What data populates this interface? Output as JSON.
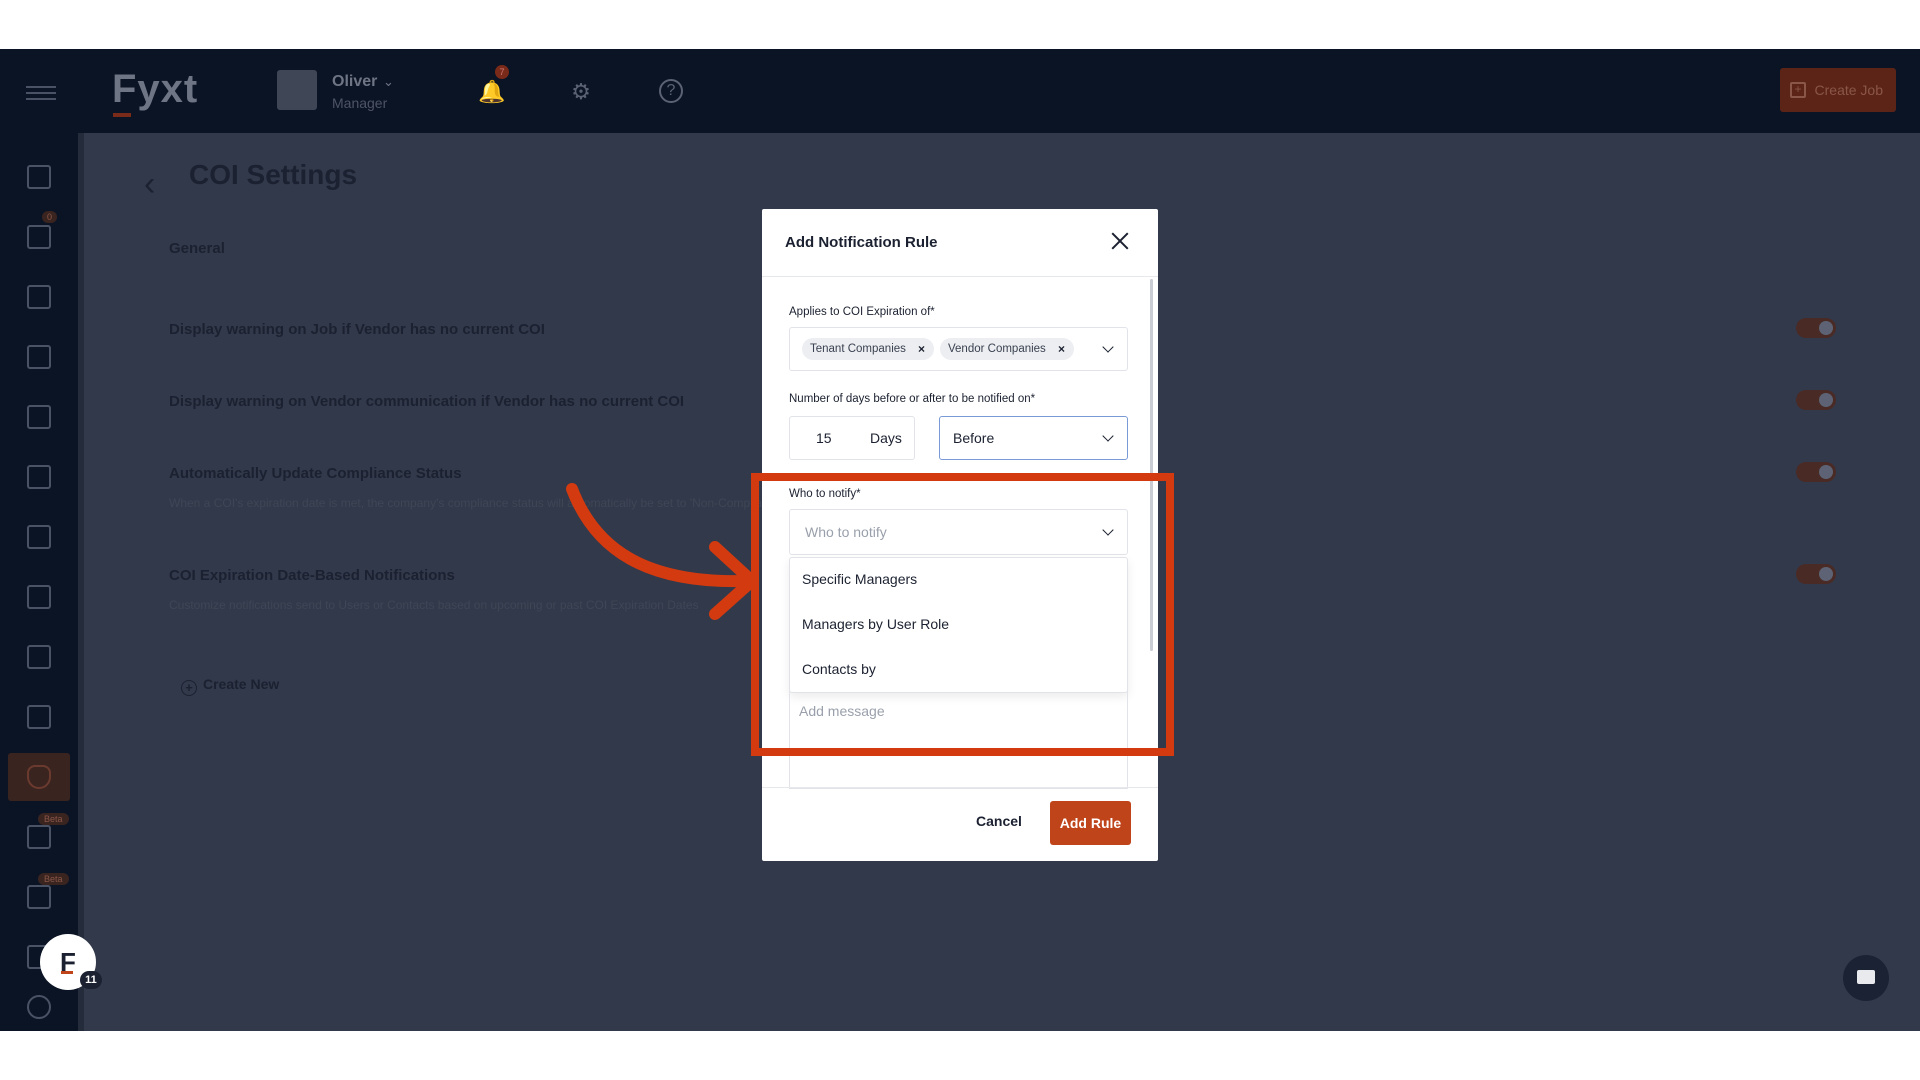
{
  "topbar": {
    "logo": "Fyxt",
    "user_name": "Oliver",
    "user_role": "Manager",
    "bell_count": "7",
    "create_job_label": "Create Job"
  },
  "sidebar": {
    "inbox_badge": "0",
    "reports_badge": "Beta",
    "analytics_badge": "Beta"
  },
  "page": {
    "title": "COI Settings",
    "section": "General",
    "settings": [
      {
        "label": "Display warning on Job if Vendor has no current COI",
        "desc": ""
      },
      {
        "label": "Display warning on Vendor communication if Vendor has no current COI",
        "desc": ""
      },
      {
        "label": "Automatically Update Compliance Status",
        "desc": "When a COI's expiration date is met, the company's compliance status will automatically be set to 'Non-Compliant'"
      },
      {
        "label": "COI Expiration Date-Based Notifications",
        "desc": "Customize notifications send to Users or Contacts based on upcoming or past COI Expiration Dates"
      }
    ],
    "create_new": "Create New"
  },
  "modal": {
    "title": "Add Notification Rule",
    "applies_label": "Applies to COI Expiration of*",
    "chips": [
      "Tenant Companies",
      "Vendor Companies"
    ],
    "days_label": "Number of days before or after to be notified on*",
    "days_value": "15",
    "days_unit": "Days",
    "timing_value": "Before",
    "notify_label": "Who to notify*",
    "notify_placeholder": "Who to notify",
    "notify_options": [
      "Specific Managers",
      "Managers by User Role",
      "Contacts by"
    ],
    "message_placeholder": "Add message",
    "cancel_label": "Cancel",
    "add_label": "Add Rule"
  },
  "fab": {
    "letter": "F",
    "count": "11"
  },
  "colors": {
    "accent": "#c0441a",
    "highlight": "#d33a0f",
    "navy": "#0b1424",
    "overlay_bg": "#32394a"
  }
}
